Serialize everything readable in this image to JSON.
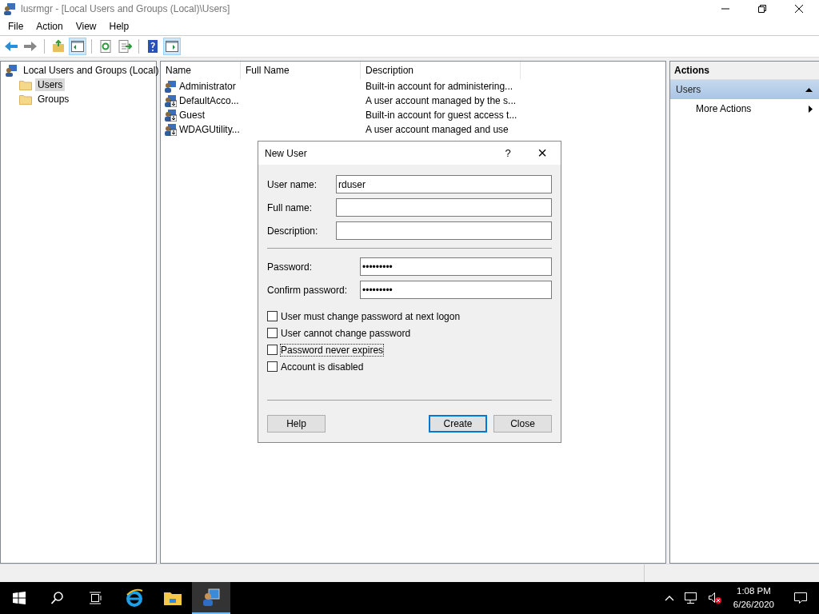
{
  "window": {
    "title": "lusrmgr - [Local Users and Groups (Local)\\Users]"
  },
  "menu": [
    "File",
    "Action",
    "View",
    "Help"
  ],
  "toolbar": [
    {
      "kind": "back",
      "selected": false
    },
    {
      "kind": "forward",
      "selected": false
    },
    {
      "kind": "up",
      "selected": false
    },
    {
      "kind": "tree",
      "selected": true
    },
    {
      "kind": "refresh",
      "selected": false
    },
    {
      "kind": "export",
      "selected": false
    },
    {
      "kind": "help",
      "selected": false
    },
    {
      "kind": "actionpane",
      "selected": true
    }
  ],
  "tree": {
    "label": "Local Users and Groups (Local)",
    "children": [
      {
        "label": "Users",
        "selected": true
      },
      {
        "label": "Groups",
        "selected": false
      }
    ]
  },
  "table": {
    "columns": [
      "Name",
      "Full Name",
      "Description"
    ],
    "rows": [
      {
        "name": "Administrator",
        "description": "Built-in account for administering...",
        "kind": "admin"
      },
      {
        "name": "DefaultAcco...",
        "description": "A user account managed by the s...",
        "kind": "disabled"
      },
      {
        "name": "Guest",
        "description": "Built-in account for guest access t...",
        "kind": "disabled"
      },
      {
        "name": "WDAGUtility...",
        "description": "A user account managed and use",
        "kind": "disabled"
      }
    ]
  },
  "actions": {
    "title": "Actions",
    "section": "Users",
    "items": [
      "More Actions"
    ]
  },
  "dialog": {
    "title": "New User",
    "help": "?",
    "close": "×",
    "name_fields": [
      {
        "label": "User name:",
        "value": "rduser"
      },
      {
        "label": "Full name:"
      },
      {
        "label": "Description:"
      }
    ],
    "password_fields": [
      {
        "label": "Password:",
        "value": "•••••••••"
      },
      {
        "label": "Confirm password:",
        "value": "•••••••••"
      }
    ],
    "checkboxes": [
      {
        "label": "User must change password at next logon",
        "checked": false,
        "focused": false
      },
      {
        "label": "User cannot change password",
        "checked": false,
        "focused": false
      },
      {
        "label": "Password never expires",
        "checked": false,
        "focused": true
      },
      {
        "label": "Account is disabled",
        "checked": false,
        "focused": false
      }
    ],
    "buttons": [
      {
        "label": "Help",
        "default": false
      },
      {
        "label": "Create",
        "default": true
      },
      {
        "label": "Close",
        "default": false
      }
    ]
  },
  "taskbar": {
    "apps": [
      {
        "kind": "ie",
        "selected": false
      },
      {
        "kind": "explorer",
        "selected": false
      },
      {
        "kind": "lusrmgr",
        "selected": true
      }
    ],
    "time": "1:08 PM",
    "date": "6/26/2020"
  }
}
